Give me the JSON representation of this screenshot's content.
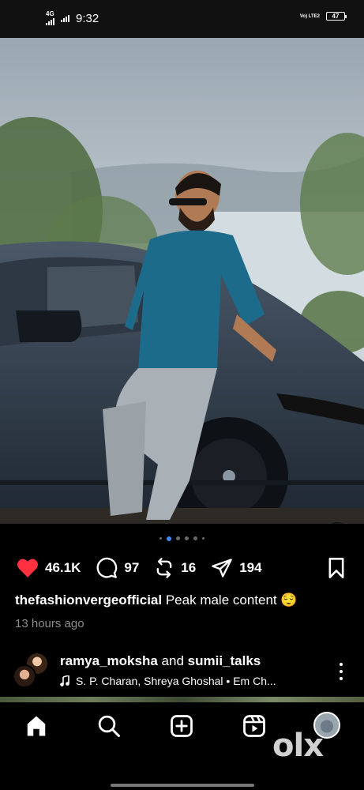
{
  "status_bar": {
    "network": "4G",
    "time": "9:32",
    "volte": "Vo) LTE2",
    "battery": "47"
  },
  "post": {
    "media_icon": "speaker-icon",
    "carousel": {
      "count": 6,
      "active_index": 1
    },
    "likes": "46.1K",
    "comments": "97",
    "reposts": "16",
    "shares": "194",
    "caption_user": "thefashionvergeofficial",
    "caption_text": "Peak male content 😌",
    "time_ago": "13 hours ago"
  },
  "next_post": {
    "user_1": "ramya_moksha",
    "joiner": "and",
    "user_2": "sumii_talks",
    "music": "S. P. Charan, Shreya Ghoshal • Em Ch..."
  },
  "bottom_nav": {
    "items": [
      "home-icon",
      "search-icon",
      "create-icon",
      "reels-icon",
      "profile-avatar"
    ],
    "watermark": "olx"
  },
  "colors": {
    "background": "#000000",
    "like_red": "#ff3040",
    "active_dot": "#3a8cf0",
    "secondary_text": "#8e8e8e"
  }
}
